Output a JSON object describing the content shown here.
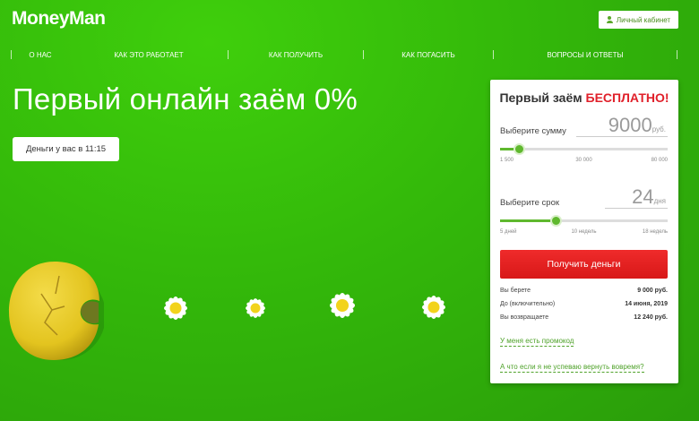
{
  "header": {
    "logo": "MoneyMan",
    "cabinet_button": "Личный кабинет"
  },
  "nav": {
    "items": [
      {
        "label": "О нас"
      },
      {
        "label": "Как это работает"
      },
      {
        "label": "Как получить"
      },
      {
        "label": "Как погасить"
      },
      {
        "label": "Вопросы и ответы"
      }
    ]
  },
  "hero": {
    "title": "Первый онлайн заём 0%",
    "money_button": "Деньги у вас в 11:15"
  },
  "card": {
    "title_prefix": "Первый заём",
    "title_highlight": "БЕСПЛАТНО!",
    "amount": {
      "label": "Выберите сумму",
      "value": "9000",
      "unit": "руб.",
      "ticks": [
        "1 500",
        "30 000",
        "80 000"
      ],
      "position": 0.11
    },
    "term": {
      "label": "Выберите срок",
      "value": "24",
      "unit": "дня",
      "ticks": [
        "5 дней",
        "10 недель",
        "18 недель"
      ],
      "position": 0.33
    },
    "get_button": "Получить деньги",
    "summary": [
      {
        "label": "Вы берете",
        "value": "9 000 руб."
      },
      {
        "label": "До (включительно)",
        "value": "14 июня, 2019"
      },
      {
        "label": "Вы возвращаете",
        "value": "12 240 руб."
      }
    ],
    "promo_link": "У меня есть промокод",
    "late_link": "А что если я не успеваю вернуть вовремя?"
  },
  "colors": {
    "brand_green": "#3cc40c",
    "accent_red": "#e0202a",
    "slider_green": "#5fb82e"
  }
}
